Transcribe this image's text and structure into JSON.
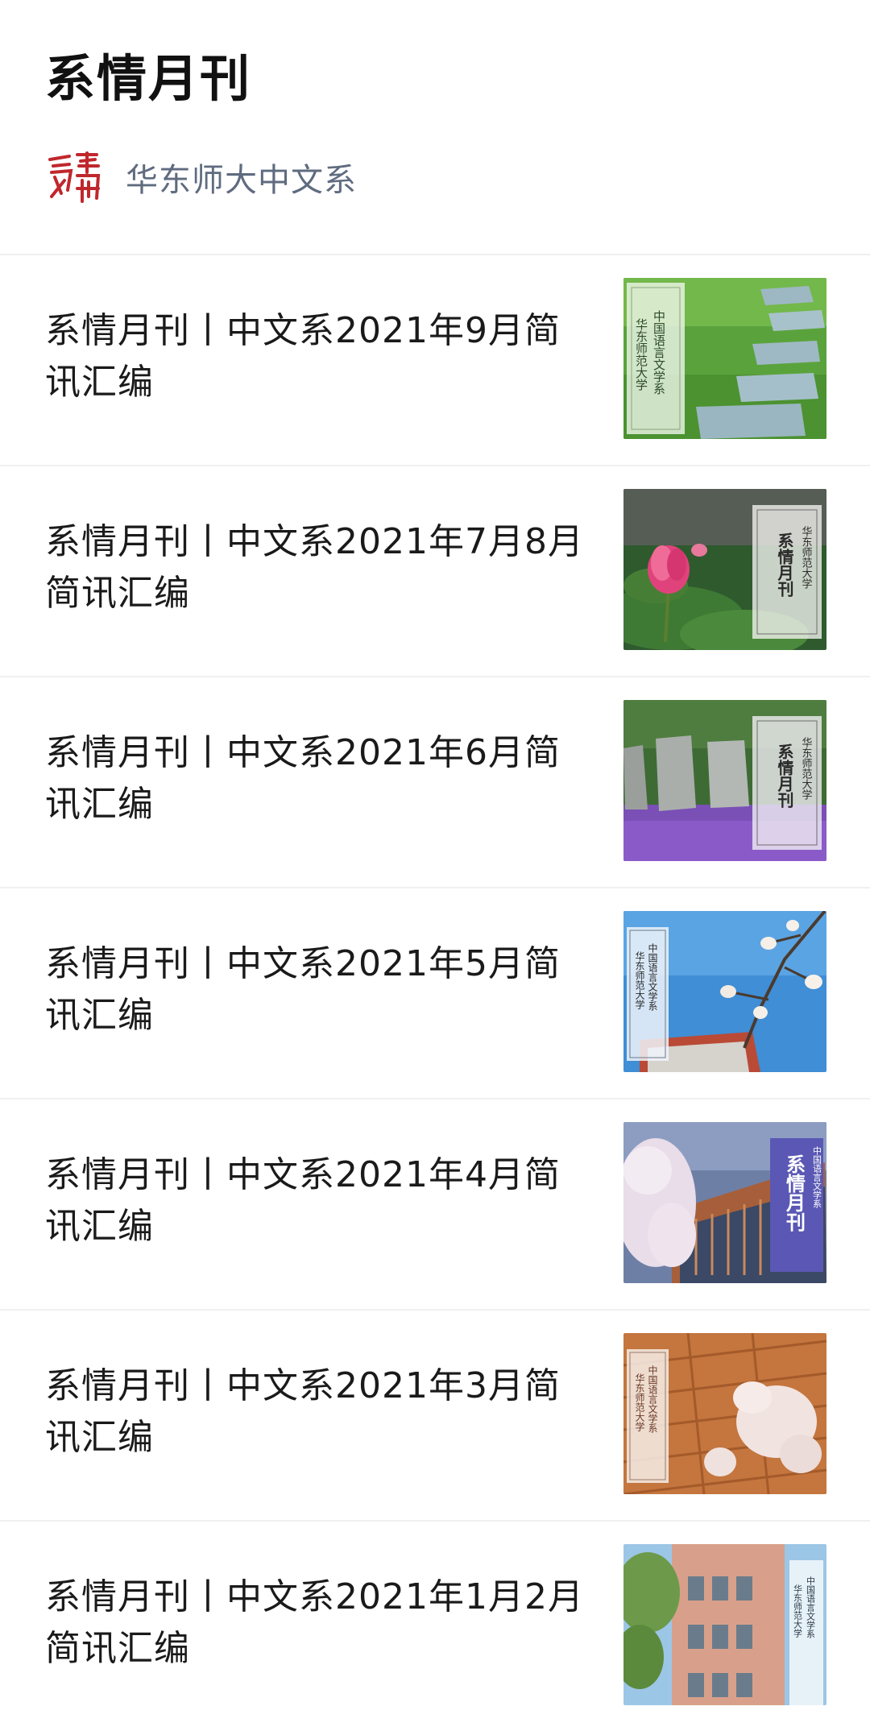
{
  "header": {
    "title": "系情月刊"
  },
  "account": {
    "name": "华东师大中文系",
    "logo_icon": "seal-logo-icon",
    "logo_color": "#c0272d"
  },
  "articles": [
    {
      "title": "系情月刊丨中文系2021年9月简讯汇编",
      "thumb_scene": "grass-stepping-stones",
      "thumb_text": "中国语言文学系 华东师范大学"
    },
    {
      "title": "系情月刊丨中文系2021年7月8月简讯汇编",
      "thumb_scene": "lotus-flower",
      "thumb_text": "系情月刊 华东师范大学"
    },
    {
      "title": "系情月刊丨中文系2021年6月简讯汇编",
      "thumb_scene": "stone-monuments-lavender",
      "thumb_text": "系情月刊 华东师范大学"
    },
    {
      "title": "系情月刊丨中文系2021年5月简讯汇编",
      "thumb_scene": "magnolia-blue-sky",
      "thumb_text": "中国语言文学系 华东师范大学"
    },
    {
      "title": "系情月刊丨中文系2021年4月简讯汇编",
      "thumb_scene": "cherry-blossom-building",
      "thumb_text": "系情月刊 中国语言文学系"
    },
    {
      "title": "系情月刊丨中文系2021年3月简讯汇编",
      "thumb_scene": "blossom-brick-wall",
      "thumb_text": "中国语言文学系 华东师范大学"
    },
    {
      "title": "系情月刊丨中文系2021年1月2月简讯汇编",
      "thumb_scene": "campus-building-sky",
      "thumb_text": "中国语言文学系 华东师范大学"
    }
  ]
}
